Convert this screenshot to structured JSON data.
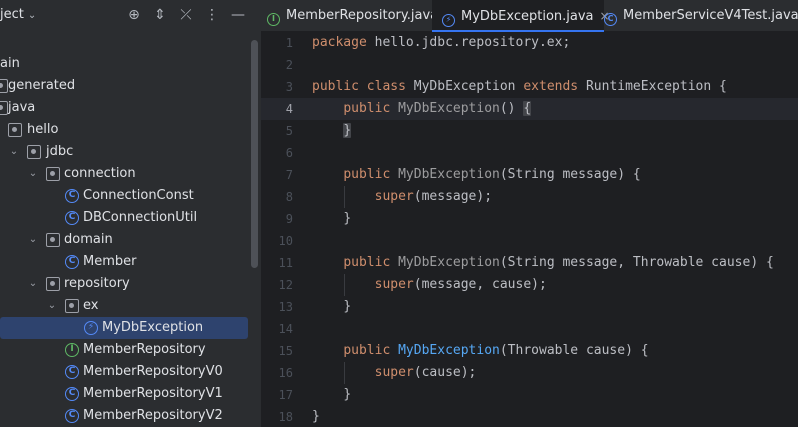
{
  "project": {
    "title": "ject",
    "tree": [
      {
        "label": "ain",
        "kind": "text"
      },
      {
        "label": "generated",
        "kind": "folder"
      },
      {
        "label": "java",
        "kind": "folder"
      },
      {
        "label": "hello",
        "kind": "folder"
      },
      {
        "label": "jdbc",
        "kind": "folder"
      },
      {
        "label": "connection",
        "kind": "folder"
      },
      {
        "label": "ConnectionConst",
        "kind": "class"
      },
      {
        "label": "DBConnectionUtil",
        "kind": "class"
      },
      {
        "label": "domain",
        "kind": "folder"
      },
      {
        "label": "Member",
        "kind": "class"
      },
      {
        "label": "repository",
        "kind": "folder"
      },
      {
        "label": "ex",
        "kind": "folder"
      },
      {
        "label": "MyDbException",
        "kind": "exception"
      },
      {
        "label": "MemberRepository",
        "kind": "interface"
      },
      {
        "label": "MemberRepositoryV0",
        "kind": "class"
      },
      {
        "label": "MemberRepositoryV1",
        "kind": "class"
      },
      {
        "label": "MemberRepositoryV2",
        "kind": "class"
      }
    ]
  },
  "tabs": [
    {
      "label": "MemberRepository.java",
      "icon": "I"
    },
    {
      "label": "MyDbException.java",
      "icon": "C"
    },
    {
      "label": "MemberServiceV4Test.java",
      "icon": "C"
    }
  ],
  "icons": {
    "class_letter": "C",
    "interface_letter": "I",
    "exception_letter": "⚡",
    "close": "×"
  },
  "editor": {
    "line_numbers": [
      "1",
      "2",
      "3",
      "4",
      "5",
      "6",
      "7",
      "8",
      "9",
      "10",
      "11",
      "12",
      "13",
      "14",
      "15",
      "16",
      "17",
      "18"
    ],
    "current_line": 4,
    "code": {
      "l1_kw": "package",
      "l1_rest": " hello.jdbc.repository.ex;",
      "l3_kw1": "public",
      "l3_kw2": "class",
      "l3_name": " MyDbException ",
      "l3_kw3": "extends",
      "l3_rest": " RuntimeException {",
      "l4_kw": "public",
      "l4_ctor": " MyDbException",
      "l4_parens": "() ",
      "l4_brace": "{",
      "l5_brace": "}",
      "l7_kw": "public",
      "l7_ctor": " MyDbException",
      "l7_rest": "(String message) {",
      "l8_kw": "super",
      "l8_rest": "(message);",
      "l9": "}",
      "l11_kw": "public",
      "l11_ctor": " MyDbException",
      "l11_rest": "(String message, Throwable cause) {",
      "l12_kw": "super",
      "l12_rest": "(message, cause);",
      "l13": "}",
      "l15_kw": "public",
      "l15_ctor": " MyDbException",
      "l15_rest": "(Throwable cause) {",
      "l16_kw": "super",
      "l16_rest": "(cause);",
      "l17": "}",
      "l18": "}"
    }
  },
  "colors": {
    "keyword": "#cf8e6d",
    "function": "#56a8f5",
    "selection": "#2e436e",
    "accent": "#3574f0"
  }
}
